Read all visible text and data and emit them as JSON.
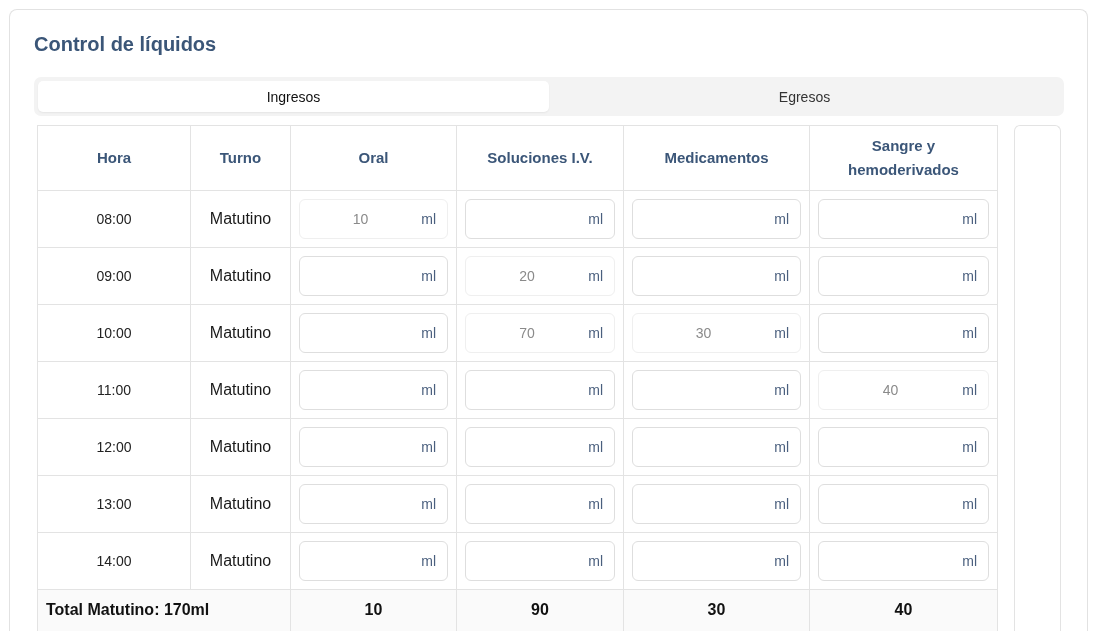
{
  "title": "Control de líquidos",
  "tabs": [
    {
      "label": "Ingresos",
      "selected": true
    },
    {
      "label": "Egresos",
      "selected": false
    }
  ],
  "table": {
    "columns": [
      "Hora",
      "Turno",
      "Oral",
      "Soluciones I.V.",
      "Medicamentos",
      "Sangre y hemoderivados"
    ],
    "rows": [
      {
        "hora": "08:00",
        "turno": "Matutino",
        "fields": [
          {
            "value": "10",
            "unit": "ml",
            "disabled": true
          },
          {
            "unit": "ml",
            "disabled": false
          },
          {
            "unit": "ml",
            "disabled": false
          },
          {
            "unit": "ml",
            "disabled": false
          }
        ]
      },
      {
        "hora": "09:00",
        "turno": "Matutino",
        "fields": [
          {
            "unit": "ml",
            "disabled": false
          },
          {
            "value": "20",
            "unit": "ml",
            "disabled": true
          },
          {
            "unit": "ml",
            "disabled": false
          },
          {
            "unit": "ml",
            "disabled": false
          }
        ]
      },
      {
        "hora": "10:00",
        "turno": "Matutino",
        "fields": [
          {
            "unit": "ml",
            "disabled": false
          },
          {
            "value": "70",
            "unit": "ml",
            "disabled": true
          },
          {
            "value": "30",
            "unit": "ml",
            "disabled": true
          },
          {
            "unit": "ml",
            "disabled": false
          }
        ]
      },
      {
        "hora": "11:00",
        "turno": "Matutino",
        "fields": [
          {
            "unit": "ml",
            "disabled": false
          },
          {
            "unit": "ml",
            "disabled": false
          },
          {
            "unit": "ml",
            "disabled": false
          },
          {
            "value": "40",
            "unit": "ml",
            "disabled": true
          }
        ]
      },
      {
        "hora": "12:00",
        "turno": "Matutino",
        "fields": [
          {
            "unit": "ml",
            "disabled": false
          },
          {
            "unit": "ml",
            "disabled": false
          },
          {
            "unit": "ml",
            "disabled": false
          },
          {
            "unit": "ml",
            "disabled": false
          }
        ]
      },
      {
        "hora": "13:00",
        "turno": "Matutino",
        "fields": [
          {
            "unit": "ml",
            "disabled": false
          },
          {
            "unit": "ml",
            "disabled": false
          },
          {
            "unit": "ml",
            "disabled": false
          },
          {
            "unit": "ml",
            "disabled": false
          }
        ]
      },
      {
        "hora": "14:00",
        "turno": "Matutino",
        "fields": [
          {
            "unit": "ml",
            "disabled": false
          },
          {
            "unit": "ml",
            "disabled": false
          },
          {
            "unit": "ml",
            "disabled": false
          },
          {
            "unit": "ml",
            "disabled": false
          }
        ]
      }
    ],
    "total": {
      "label": "Total Matutino: 170ml",
      "values": [
        "10",
        "90",
        "30",
        "40"
      ]
    }
  }
}
